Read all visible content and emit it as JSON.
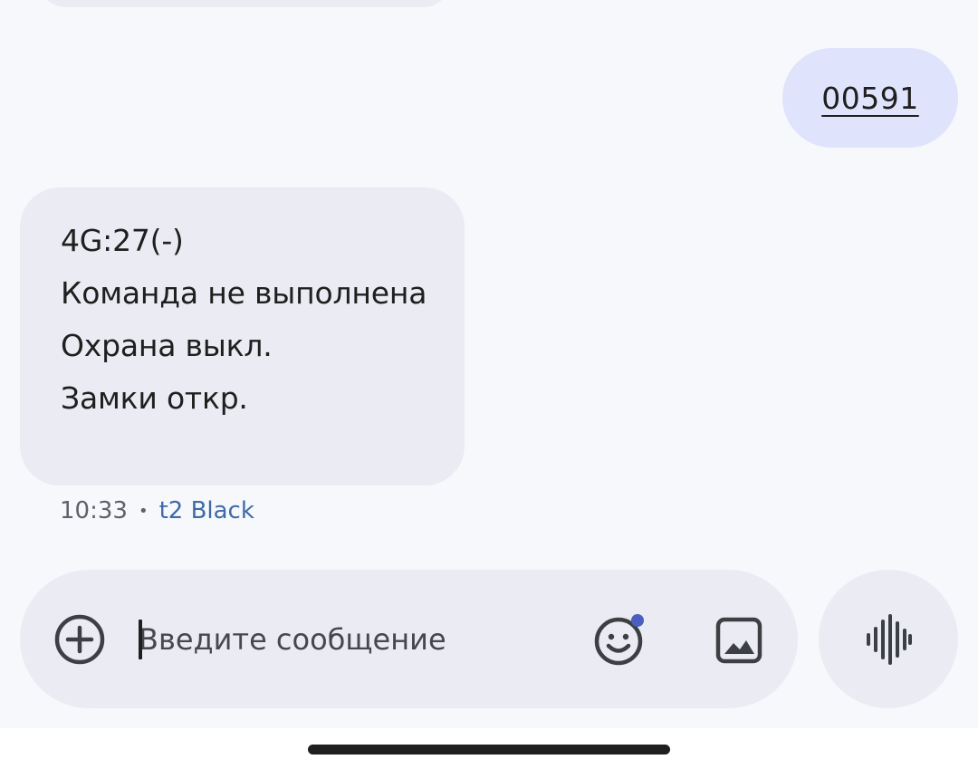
{
  "conversation": {
    "outgoing_message": {
      "text": "00591"
    },
    "incoming_message": {
      "lines": [
        "4G:27(-)",
        "Команда не выполнена",
        "Охрана выкл.",
        "Замки откр."
      ],
      "time": "10:33",
      "separator": "•",
      "sim": "t2 Black"
    }
  },
  "composer": {
    "placeholder": "Введите сообщение",
    "value": ""
  },
  "icons": {
    "attach": "add-circle-icon",
    "emoji": "emoji-icon",
    "gallery": "image-icon",
    "voice": "voice-waveform-icon"
  },
  "colors": {
    "background": "#f6f8fc",
    "incoming_bubble": "#ebebf3",
    "outgoing_bubble": "#dfe3fb",
    "sim_label": "#3f6aa7",
    "notification_dot": "#4a5fc1"
  }
}
